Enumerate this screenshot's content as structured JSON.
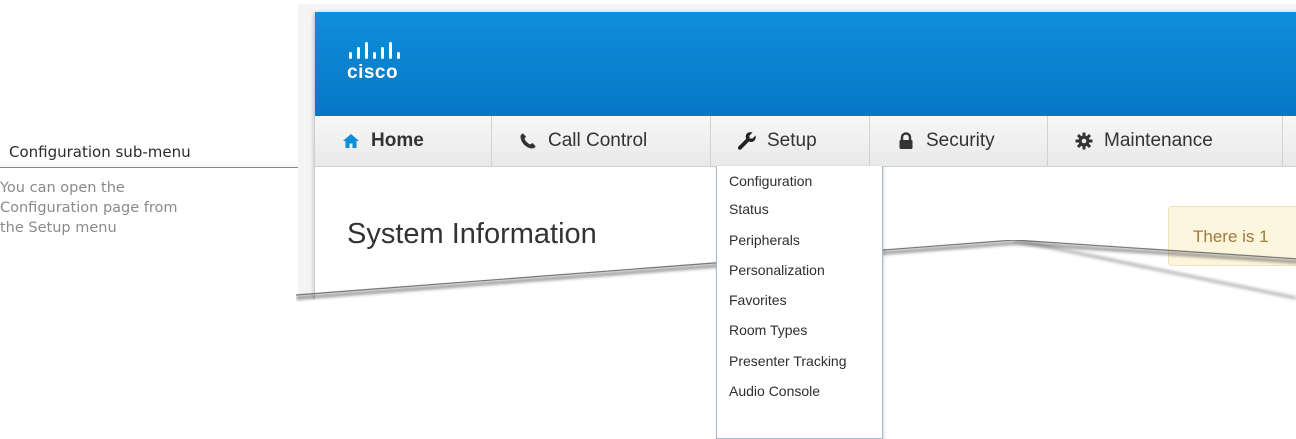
{
  "annotation": {
    "title": "Configuration sub-menu",
    "body_lines": [
      "You can open the",
      "Configuration page from",
      "the Setup menu"
    ]
  },
  "header": {
    "logo_text": "cisco",
    "brand_color": "#0a82cf"
  },
  "nav": {
    "home": "Home",
    "call_control": "Call Control",
    "setup": "Setup",
    "security": "Security",
    "maintenance": "Maintenance"
  },
  "main": {
    "title": "System Information",
    "notice": "There is 1"
  },
  "setup_menu": {
    "items": [
      "Configuration",
      "Status",
      "Peripherals",
      "Personalization",
      "Favorites",
      "Room Types",
      "Presenter Tracking",
      "Audio Console"
    ]
  }
}
